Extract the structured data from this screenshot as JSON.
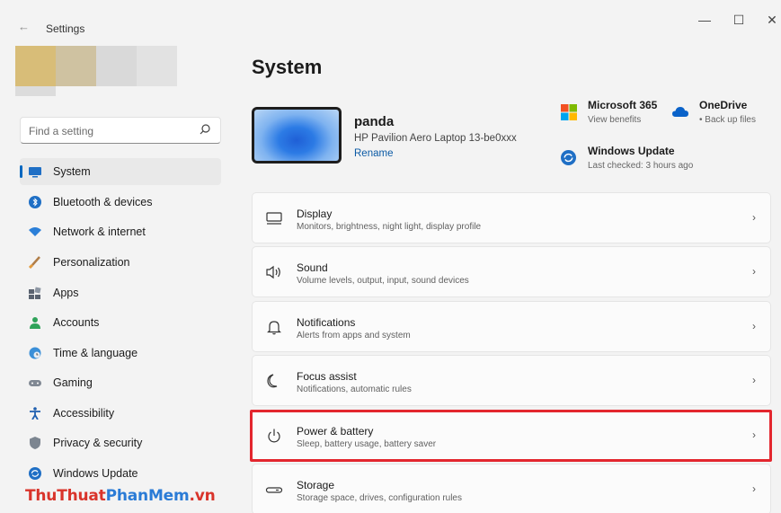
{
  "window": {
    "title": "Settings",
    "back_glyph": "←",
    "minimize_glyph": "—",
    "maximize_glyph": "☐",
    "close_glyph": "✕"
  },
  "search": {
    "placeholder": "Find a setting"
  },
  "sidebar": {
    "items": [
      {
        "label": "System",
        "icon": "system-icon",
        "active": true
      },
      {
        "label": "Bluetooth & devices",
        "icon": "bluetooth-icon"
      },
      {
        "label": "Network & internet",
        "icon": "wifi-icon"
      },
      {
        "label": "Personalization",
        "icon": "brush-icon"
      },
      {
        "label": "Apps",
        "icon": "apps-icon"
      },
      {
        "label": "Accounts",
        "icon": "person-icon"
      },
      {
        "label": "Time & language",
        "icon": "globe-clock-icon"
      },
      {
        "label": "Gaming",
        "icon": "gamepad-icon"
      },
      {
        "label": "Accessibility",
        "icon": "accessibility-icon"
      },
      {
        "label": "Privacy & security",
        "icon": "shield-icon"
      },
      {
        "label": "Windows Update",
        "icon": "update-icon"
      }
    ]
  },
  "main": {
    "title": "System",
    "device": {
      "name": "panda",
      "model": "HP Pavilion Aero Laptop 13-be0xxx",
      "rename": "Rename"
    },
    "services": [
      {
        "title": "Microsoft 365",
        "subtitle": "View benefits"
      },
      {
        "title": "OneDrive",
        "subtitle": "• Back up files"
      },
      {
        "title": "Windows Update",
        "subtitle": "Last checked: 3 hours ago"
      }
    ],
    "cards": [
      {
        "title": "Display",
        "subtitle": "Monitors, brightness, night light, display profile",
        "icon": "monitor-icon"
      },
      {
        "title": "Sound",
        "subtitle": "Volume levels, output, input, sound devices",
        "icon": "speaker-icon"
      },
      {
        "title": "Notifications",
        "subtitle": "Alerts from apps and system",
        "icon": "bell-icon"
      },
      {
        "title": "Focus assist",
        "subtitle": "Notifications, automatic rules",
        "icon": "moon-icon"
      },
      {
        "title": "Power & battery",
        "subtitle": "Sleep, battery usage, battery saver",
        "icon": "power-icon"
      },
      {
        "title": "Storage",
        "subtitle": "Storage space, drives, configuration rules",
        "icon": "storage-icon"
      }
    ],
    "chevron": "›"
  },
  "watermark": {
    "part1": "ThuThuat",
    "part2": "PhanMem",
    "part3": ".vn"
  },
  "colors": {
    "accent": "#0067c0",
    "highlight": "#e3262e"
  }
}
